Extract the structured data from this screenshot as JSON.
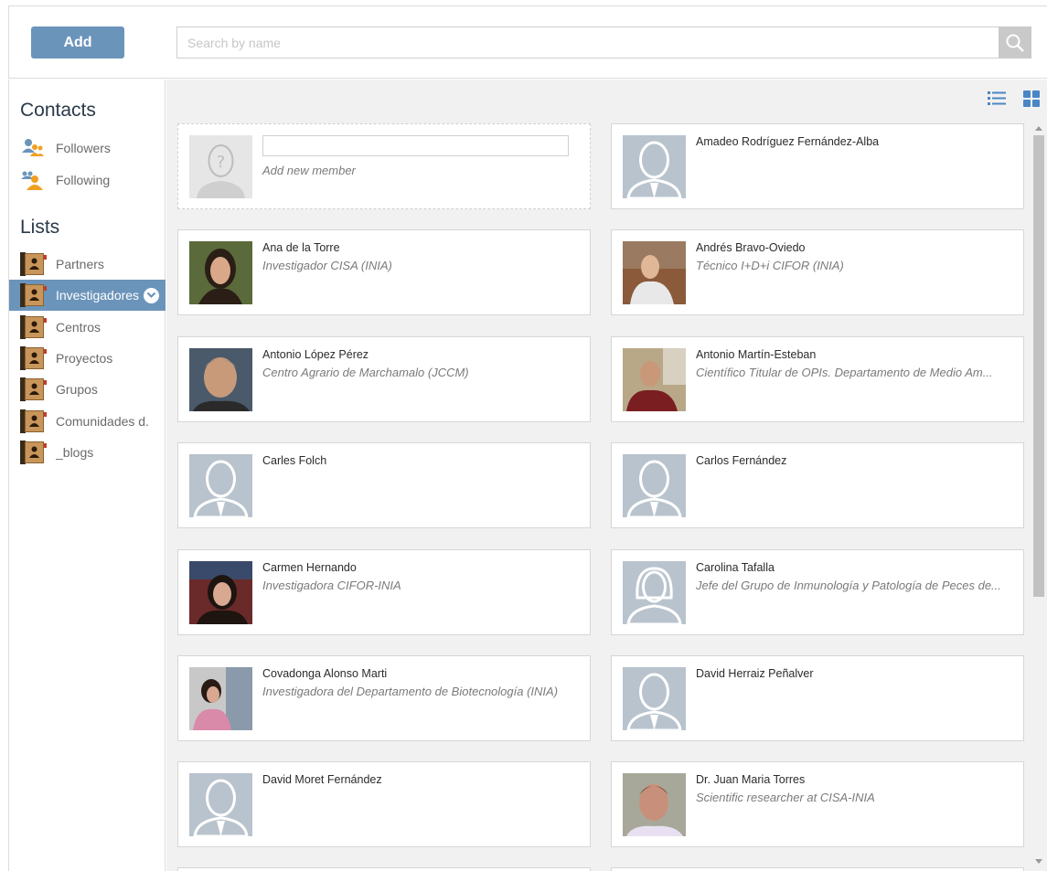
{
  "toolbar": {
    "add_label": "Add",
    "search_placeholder": "Search by name"
  },
  "sidebar": {
    "contacts_title": "Contacts",
    "contacts": [
      {
        "label": "Followers",
        "icon": "followers-icon"
      },
      {
        "label": "Following",
        "icon": "following-icon"
      }
    ],
    "lists_title": "Lists",
    "lists": [
      {
        "label": "Partners",
        "active": false
      },
      {
        "label": "Investigadores",
        "active": true
      },
      {
        "label": "Centros",
        "active": false
      },
      {
        "label": "Proyectos",
        "active": false
      },
      {
        "label": "Grupos",
        "active": false
      },
      {
        "label": "Comunidades d.",
        "active": false
      },
      {
        "label": "_blogs",
        "active": false
      }
    ]
  },
  "new_member": {
    "label": "Add new member"
  },
  "members": [
    {
      "name": "Amadeo Rodríguez Fernández-Alba",
      "role": "",
      "avatar": "placeholder"
    },
    {
      "name": "Ana de la Torre",
      "role": "Investigador CISA (INIA)",
      "avatar": "photo"
    },
    {
      "name": "Andrés Bravo-Oviedo",
      "role": "Técnico I+D+i CIFOR (INIA)",
      "avatar": "photo"
    },
    {
      "name": "Antonio López Pérez",
      "role": "Centro Agrario de Marchamalo (JCCM)",
      "avatar": "photo"
    },
    {
      "name": "Antonio Martín-Esteban",
      "role": "Científico Titular de OPIs. Departamento de Medio Am...",
      "avatar": "photo"
    },
    {
      "name": "Carles Folch",
      "role": "",
      "avatar": "placeholder"
    },
    {
      "name": "Carlos Fernández",
      "role": "",
      "avatar": "placeholder"
    },
    {
      "name": "Carmen Hernando",
      "role": "Investigadora CIFOR-INIA",
      "avatar": "photo"
    },
    {
      "name": "Carolina Tafalla",
      "role": "Jefe del Grupo de Inmunología y Patología de Peces de...",
      "avatar": "placeholder-female"
    },
    {
      "name": "Covadonga Alonso Marti",
      "role": "Investigadora del Departamento de Biotecnología (INIA)",
      "avatar": "photo"
    },
    {
      "name": "David Herraiz Peñalver",
      "role": "",
      "avatar": "placeholder"
    },
    {
      "name": "David Moret Fernández",
      "role": "",
      "avatar": "placeholder"
    },
    {
      "name": "Dr. Juan Maria Torres",
      "role": "Scientific researcher at CISA-INIA",
      "avatar": "photo"
    }
  ],
  "colors": {
    "accent": "#6b94ba",
    "placeholder_avatar": "#b8c3cd"
  }
}
